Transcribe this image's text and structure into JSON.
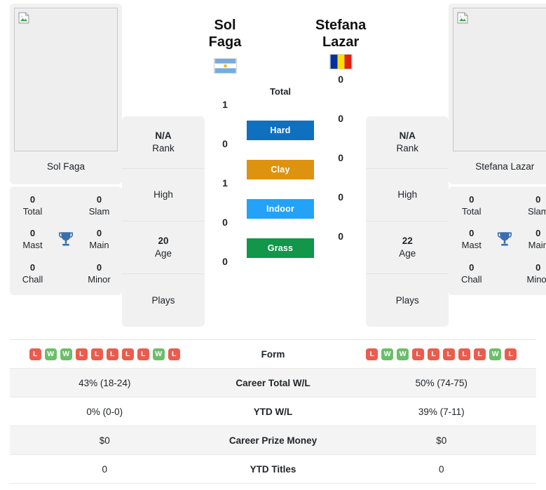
{
  "left_player": {
    "name": "Sol Faga",
    "photo_name": "Sol Faga",
    "photo_alt_icon": "broken-image-icon",
    "flag": "argentina-flag",
    "rank_value": "N/A",
    "rank_label": "Rank",
    "high_value": "",
    "high_label": "High",
    "age_value": "20",
    "age_label": "Age",
    "plays_value": "",
    "plays_label": "Plays",
    "titles": {
      "total_value": "0",
      "total_label": "Total",
      "slam_value": "0",
      "slam_label": "Slam",
      "mast_value": "0",
      "mast_label": "Mast",
      "main_value": "0",
      "main_label": "Main",
      "chall_value": "0",
      "chall_label": "Chall",
      "minor_value": "0",
      "minor_label": "Minor"
    },
    "form": [
      "L",
      "W",
      "W",
      "L",
      "L",
      "L",
      "L",
      "L",
      "W",
      "L"
    ],
    "career_total_wl": "43% (18-24)",
    "ytd_wl": "0% (0-0)",
    "career_prize_money": "$0",
    "ytd_titles": "0"
  },
  "right_player": {
    "name": "Stefana Lazar",
    "name_line1": "Stefana",
    "name_line2": "Lazar",
    "photo_name": "Stefana Lazar",
    "photo_alt_icon": "broken-image-icon",
    "flag": "romania-flag",
    "rank_value": "N/A",
    "rank_label": "Rank",
    "high_value": "",
    "high_label": "High",
    "age_value": "22",
    "age_label": "Age",
    "plays_value": "",
    "plays_label": "Plays",
    "titles": {
      "total_value": "0",
      "total_label": "Total",
      "slam_value": "0",
      "slam_label": "Slam",
      "mast_value": "0",
      "mast_label": "Mast",
      "main_value": "0",
      "main_label": "Main",
      "chall_value": "0",
      "chall_label": "Chall",
      "minor_value": "0",
      "minor_label": "Minor"
    },
    "form": [
      "L",
      "W",
      "W",
      "L",
      "L",
      "L",
      "L",
      "L",
      "W",
      "L"
    ],
    "career_total_wl": "50% (74-75)",
    "ytd_wl": "39% (7-11)",
    "career_prize_money": "$0",
    "ytd_titles": "0"
  },
  "head_to_head": {
    "rows": [
      {
        "label": "Total",
        "left": "1",
        "right": "0",
        "style": "plain",
        "color": ""
      },
      {
        "label": "Hard",
        "left": "0",
        "right": "0",
        "style": "pill",
        "color": "#0f70c0"
      },
      {
        "label": "Clay",
        "left": "1",
        "right": "0",
        "style": "pill",
        "color": "#dd9210"
      },
      {
        "label": "Indoor",
        "left": "0",
        "right": "0",
        "style": "pill",
        "color": "#23a2f7"
      },
      {
        "label": "Grass",
        "left": "0",
        "right": "0",
        "style": "pill",
        "color": "#11964a"
      }
    ]
  },
  "comparison_table": {
    "rows": [
      {
        "label": "Form",
        "type": "form"
      },
      {
        "label": "Career Total W/L",
        "type": "text",
        "left": "43% (18-24)",
        "right": "50% (74-75)"
      },
      {
        "label": "YTD W/L",
        "type": "text",
        "left": "0% (0-0)",
        "right": "39% (7-11)"
      },
      {
        "label": "Career Prize Money",
        "type": "text",
        "left": "$0",
        "right": "$0"
      },
      {
        "label": "YTD Titles",
        "type": "text",
        "left": "0",
        "right": "0"
      }
    ]
  },
  "colors": {
    "hard": "#0f70c0",
    "clay": "#dd9210",
    "indoor": "#23a2f7",
    "grass": "#11964a",
    "win": "#6abf69",
    "loss": "#ed5b4c",
    "card_bg": "#f1f1f1",
    "trophy": "#3a6ead"
  }
}
